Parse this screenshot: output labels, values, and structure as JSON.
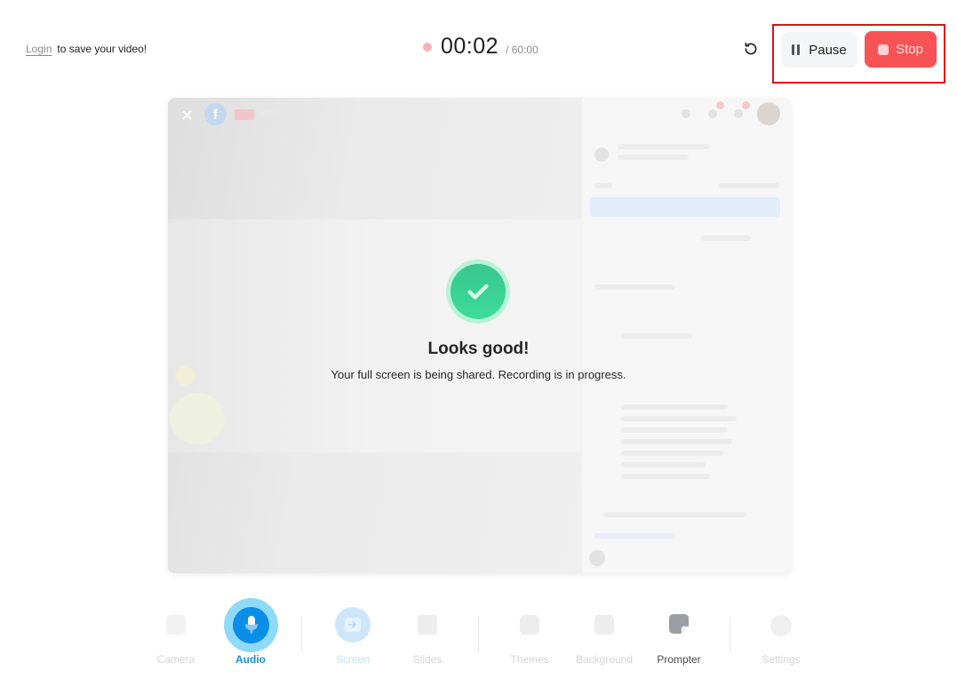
{
  "header": {
    "login_link": "Login",
    "login_suffix": "to save your video!",
    "timer_elapsed": "00:02",
    "timer_limit": "/ 60:00",
    "restart_icon": "restart-icon",
    "pause_label": "Pause",
    "stop_label": "Stop"
  },
  "overlay": {
    "title": "Looks good!",
    "message": "Your full screen is being shared. Recording is in progress."
  },
  "preview": {
    "close_glyph": "✕",
    "fb_glyph": "f"
  },
  "toolbar": {
    "items": [
      {
        "label": "Camera",
        "icon": "camera-icon",
        "state": "disabled"
      },
      {
        "label": "Audio",
        "icon": "microphone-icon",
        "state": "active"
      },
      {
        "label": "Screen",
        "icon": "screen-share-icon",
        "state": "active-faded"
      },
      {
        "label": "Slides",
        "icon": "slides-icon",
        "state": "disabled"
      },
      {
        "label": "Themes",
        "icon": "themes-icon",
        "state": "disabled"
      },
      {
        "label": "Background",
        "icon": "background-icon",
        "state": "disabled"
      },
      {
        "label": "Prompter",
        "icon": "prompter-icon",
        "state": "enabled"
      },
      {
        "label": "Settings",
        "icon": "settings-icon",
        "state": "disabled"
      }
    ]
  },
  "colors": {
    "accent_blue": "#0a8ee8",
    "stop_red": "#f75355",
    "success_green": "#3ddc9a",
    "highlight_border": "#d9141a"
  }
}
